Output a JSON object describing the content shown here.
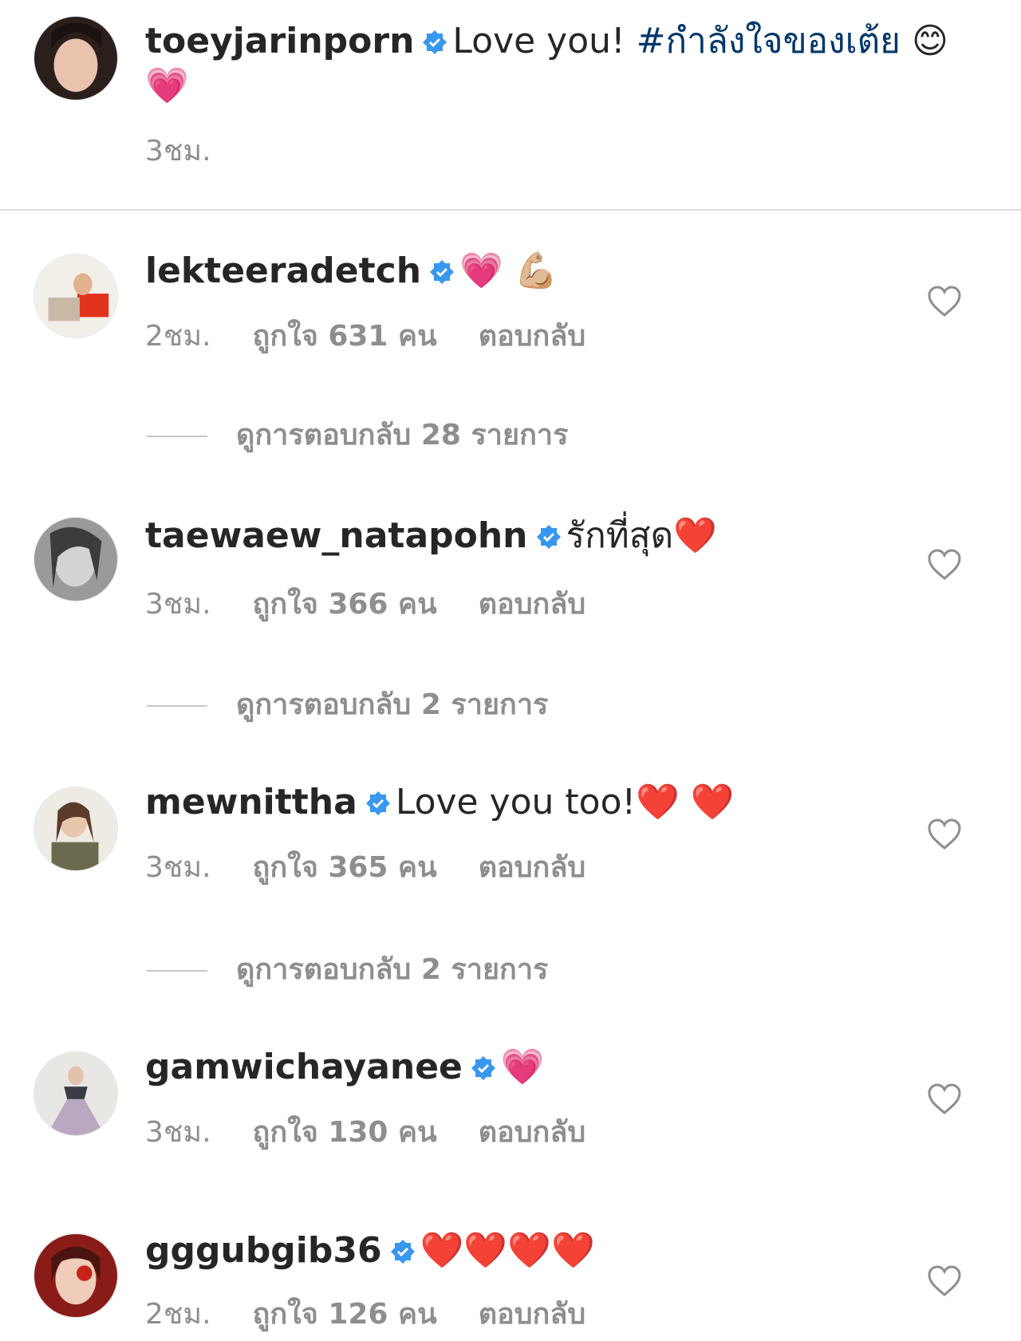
{
  "caption": {
    "username": "toeyjarinporn",
    "text": "Love you! ",
    "hashtag": "#กำลังใจของเต้ย",
    "emoji": "😊 💗",
    "time": "3ชม."
  },
  "comments": [
    {
      "username": "lekteeradetch",
      "text": "💗 💪🏼",
      "time": "2ชม.",
      "likes": "ถูกใจ 631 คน",
      "reply": "ตอบกลับ",
      "view_replies": "ดูการตอบกลับ 28 รายการ"
    },
    {
      "username": "taewaew_natapohn",
      "text": "รักที่สุด❤️",
      "time": "3ชม.",
      "likes": "ถูกใจ 366 คน",
      "reply": "ตอบกลับ",
      "view_replies": "ดูการตอบกลับ 2 รายการ"
    },
    {
      "username": "mewnittha",
      "text": "Love you too!❤️ ❤️",
      "time": "3ชม.",
      "likes": "ถูกใจ 365 คน",
      "reply": "ตอบกลับ",
      "view_replies": "ดูการตอบกลับ 2 รายการ"
    },
    {
      "username": "gamwichayanee",
      "text": "💗",
      "time": "3ชม.",
      "likes": "ถูกใจ 130 คน",
      "reply": "ตอบกลับ"
    },
    {
      "username": "gggubgib36",
      "text": "❤️❤️❤️❤️",
      "time": "2ชม.",
      "likes": "ถูกใจ 126 คน",
      "reply": "ตอบกลับ"
    }
  ],
  "icons": {
    "verified": "verified-badge-icon",
    "like": "heart-outline-icon"
  },
  "colors": {
    "verified": "#3897f0",
    "hashtag": "#00376b",
    "meta": "#8e8e8e"
  }
}
